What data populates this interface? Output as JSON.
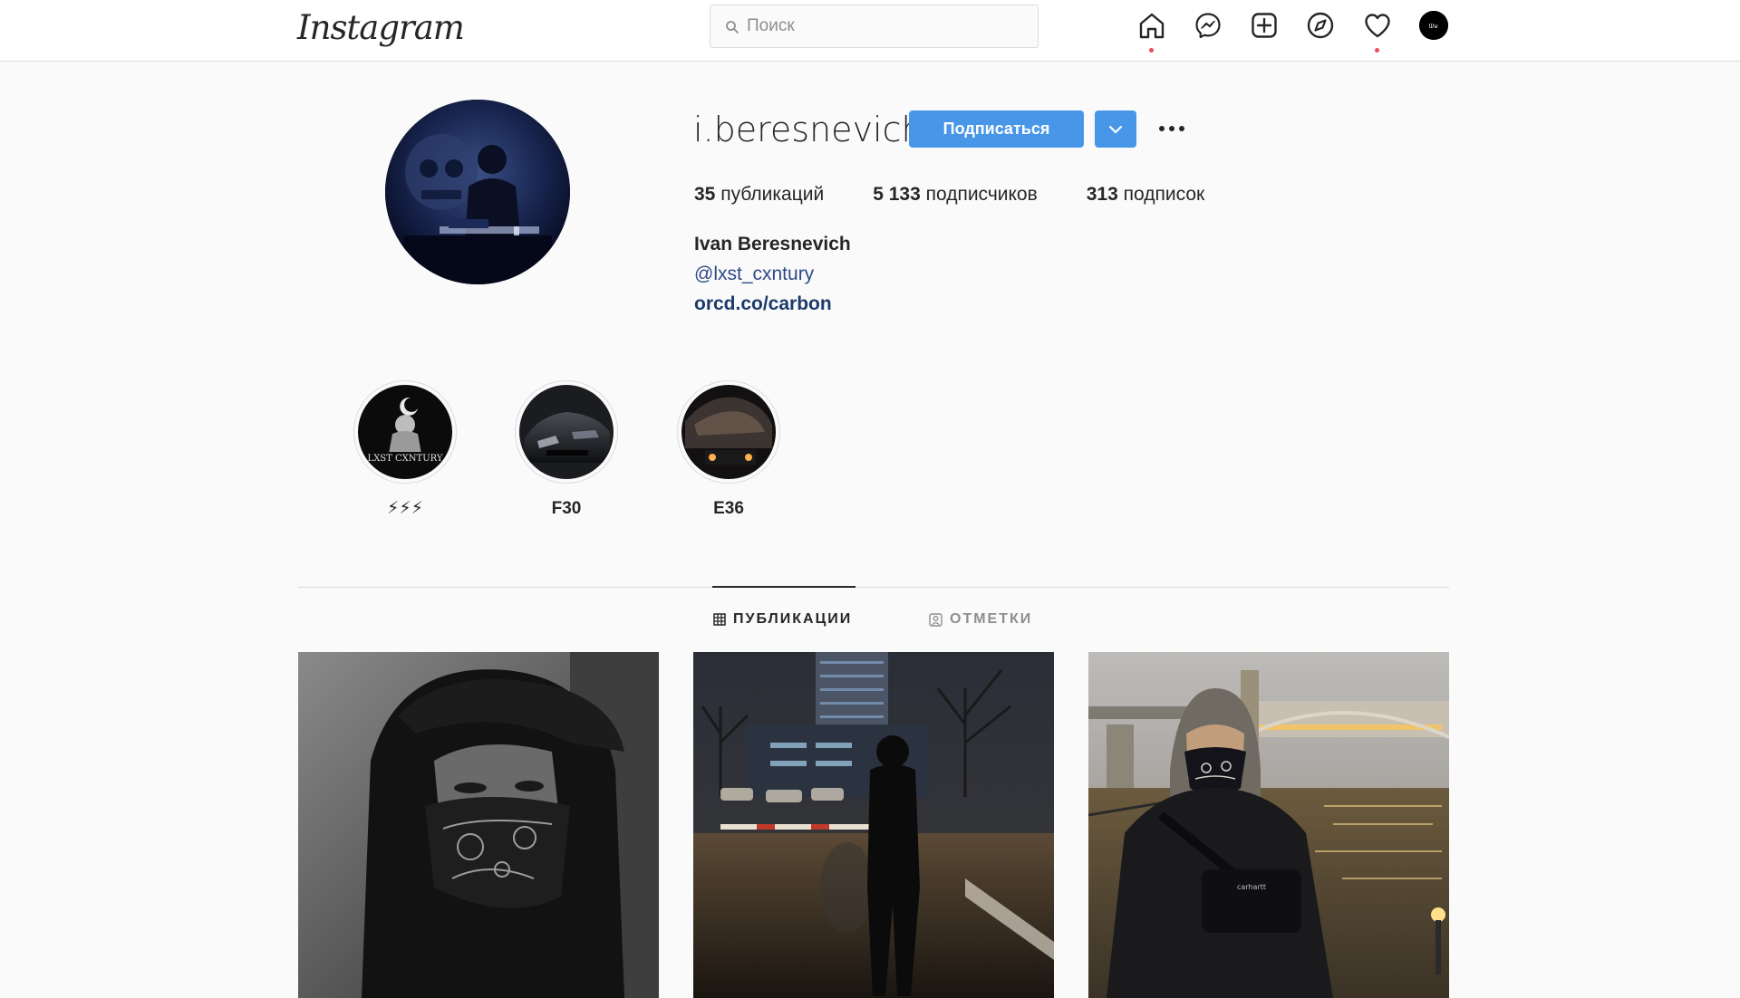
{
  "header": {
    "logo": "Instagram",
    "search_placeholder": "Поиск",
    "icons": [
      "home-icon",
      "messenger-icon",
      "new-post-icon",
      "explore-icon",
      "activity-icon",
      "profile-avatar"
    ],
    "notification_color": "#ed4956"
  },
  "profile": {
    "username": "i.beresnevich",
    "follow_label": "Подписаться",
    "accent_color": "#4796e8",
    "stats": {
      "posts_count": "35",
      "posts_label": "публикаций",
      "followers_count": "5 133",
      "followers_label": "подписчиков",
      "following_count": "313",
      "following_label": "подписок"
    },
    "full_name": "Ivan Beresnevich",
    "mention": "@lxst_cxntury",
    "link": "orcd.co/carbon"
  },
  "highlights": [
    {
      "label": "⚡⚡⚡"
    },
    {
      "label": "F30"
    },
    {
      "label": "E36"
    }
  ],
  "tabs": [
    {
      "label": "ПУБЛИКАЦИИ",
      "icon": "grid-icon",
      "active": true
    },
    {
      "label": "ОТМЕТКИ",
      "icon": "tagged-icon",
      "active": false
    }
  ]
}
